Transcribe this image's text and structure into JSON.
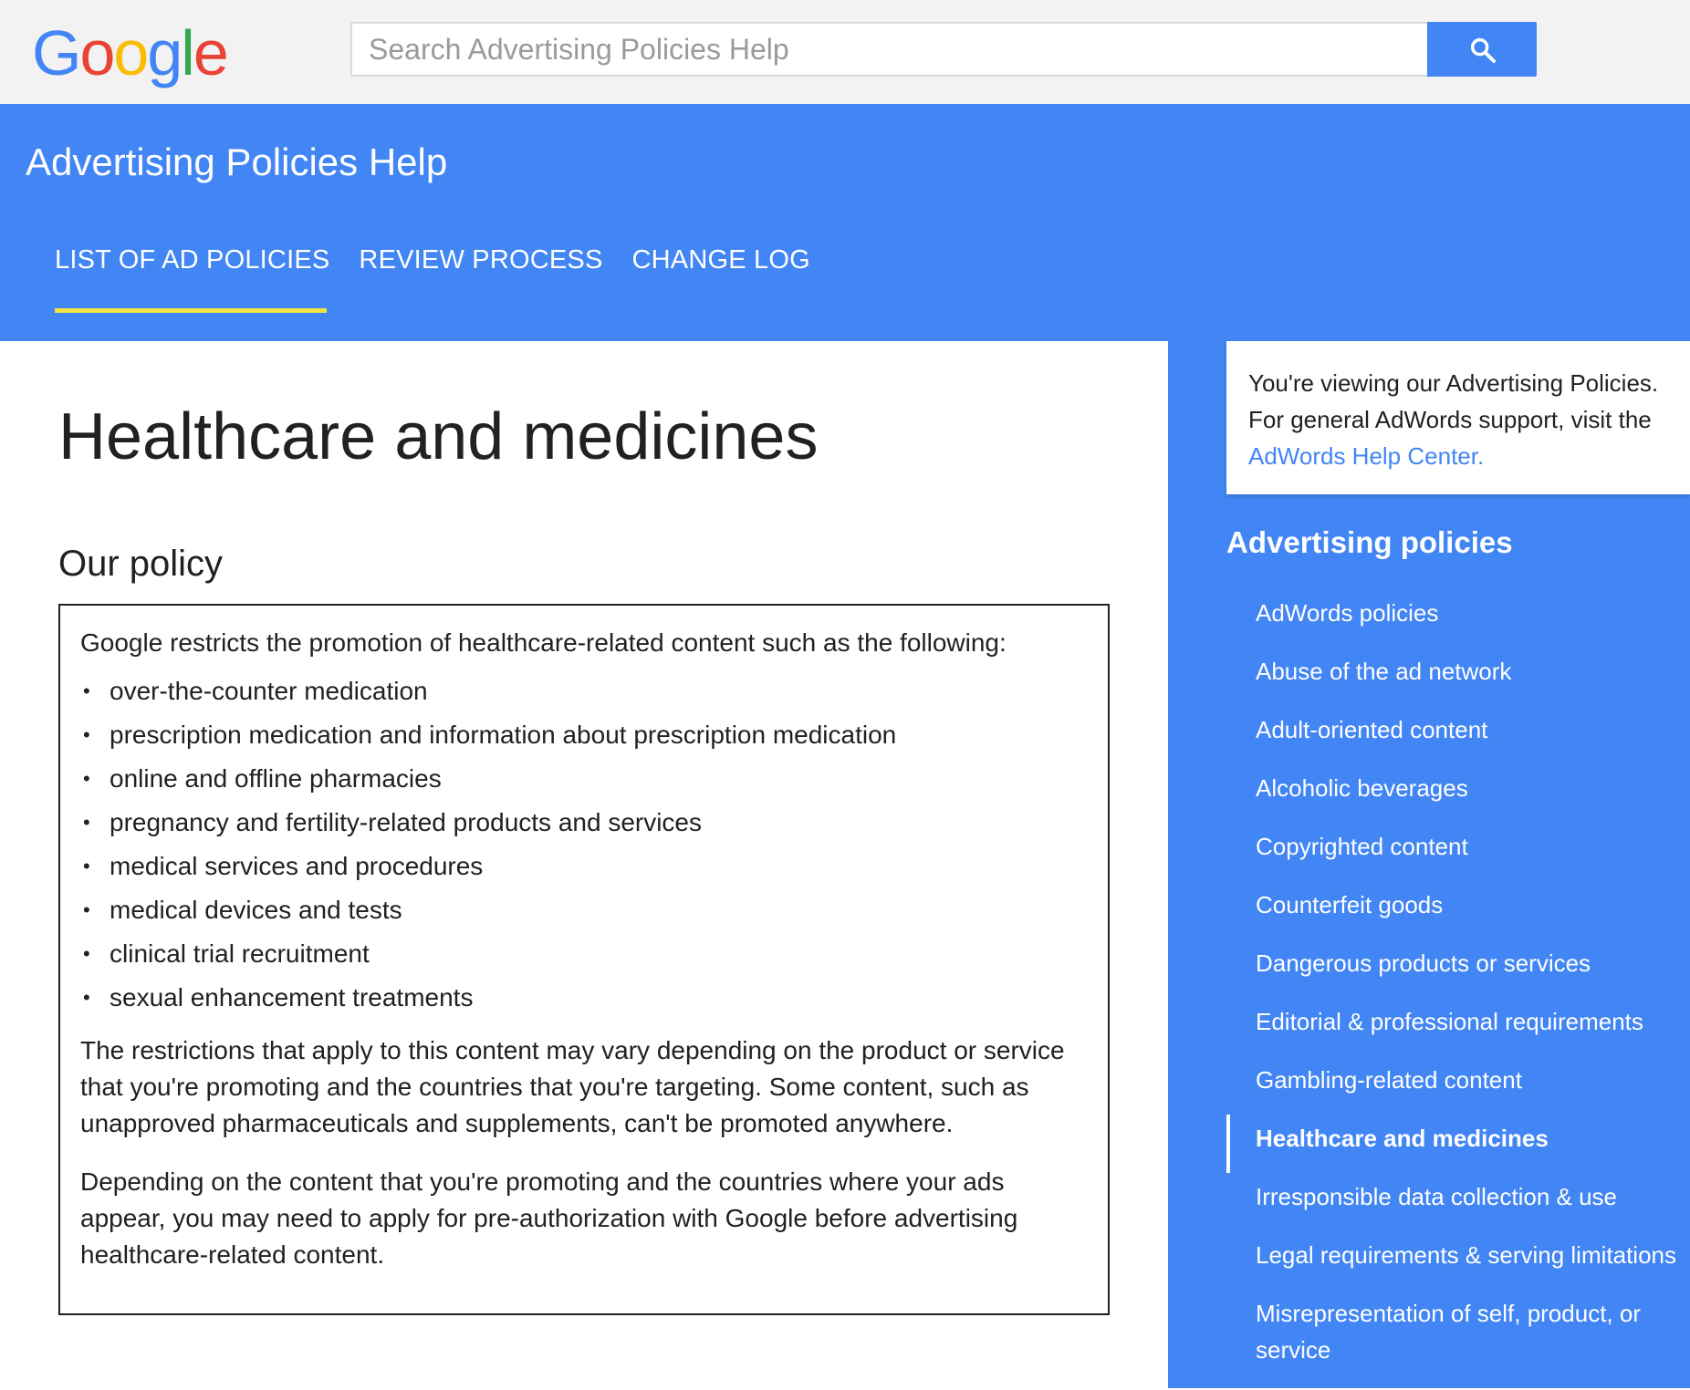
{
  "logo": {
    "letters": [
      "G",
      "o",
      "o",
      "g",
      "l",
      "e"
    ],
    "colors": [
      "#4285f4",
      "#ea4335",
      "#fbbc05",
      "#4285f4",
      "#34a853",
      "#ea4335"
    ],
    "icon": "google-logo"
  },
  "search": {
    "placeholder": "Search Advertising Policies Help",
    "value": "",
    "button_icon": "search-icon"
  },
  "header": {
    "title": "Advertising Policies Help",
    "tabs": [
      {
        "label": "LIST OF AD POLICIES",
        "active": true
      },
      {
        "label": "REVIEW PROCESS",
        "active": false
      },
      {
        "label": "CHANGE LOG",
        "active": false
      }
    ]
  },
  "main": {
    "title": "Healthcare and medicines",
    "section_heading": "Our policy",
    "intro": "Google restricts the promotion of healthcare-related content such as the following:",
    "items": [
      "over-the-counter medication",
      "prescription medication and information about prescription medication",
      "online and offline pharmacies",
      "pregnancy and fertility-related products and services",
      "medical services and procedures",
      "medical devices and tests",
      "clinical trial recruitment",
      "sexual enhancement treatments"
    ],
    "bullet": "•",
    "paragraph_1": "The restrictions that apply to this content may vary depending on the product or service that you're promoting and the countries that you're targeting. Some content, such as unapproved pharmaceuticals and supplements, can't be promoted anywhere.",
    "paragraph_2": "Depending on the content that you're promoting and the countries where your ads appear, you may need to apply for pre-authorization with Google before advertising healthcare-related content."
  },
  "sidebar": {
    "notice": {
      "line_1": "You're viewing our Advertising Policies.",
      "line_2": "For general AdWords support, visit the",
      "link": "AdWords Help Center."
    },
    "heading": "Advertising policies",
    "items": [
      {
        "label": "AdWords policies",
        "active": false
      },
      {
        "label": "Abuse of the ad network",
        "active": false
      },
      {
        "label": "Adult-oriented content",
        "active": false
      },
      {
        "label": "Alcoholic beverages",
        "active": false
      },
      {
        "label": "Copyrighted content",
        "active": false
      },
      {
        "label": "Counterfeit goods",
        "active": false
      },
      {
        "label": "Dangerous products or services",
        "active": false
      },
      {
        "label": "Editorial & professional requirements",
        "active": false
      },
      {
        "label": "Gambling-related content",
        "active": false
      },
      {
        "label": "Healthcare and medicines",
        "active": true
      },
      {
        "label": "Irresponsible data collection & use",
        "active": false
      },
      {
        "label": "Legal requirements & serving limitations",
        "active": false
      },
      {
        "label": "Misrepresentation of self, product, or service",
        "active": false
      }
    ]
  },
  "colors": {
    "brand_blue": "#4285f4",
    "tab_indicator": "#f4e242",
    "topbar_bg": "#f2f2f2"
  }
}
